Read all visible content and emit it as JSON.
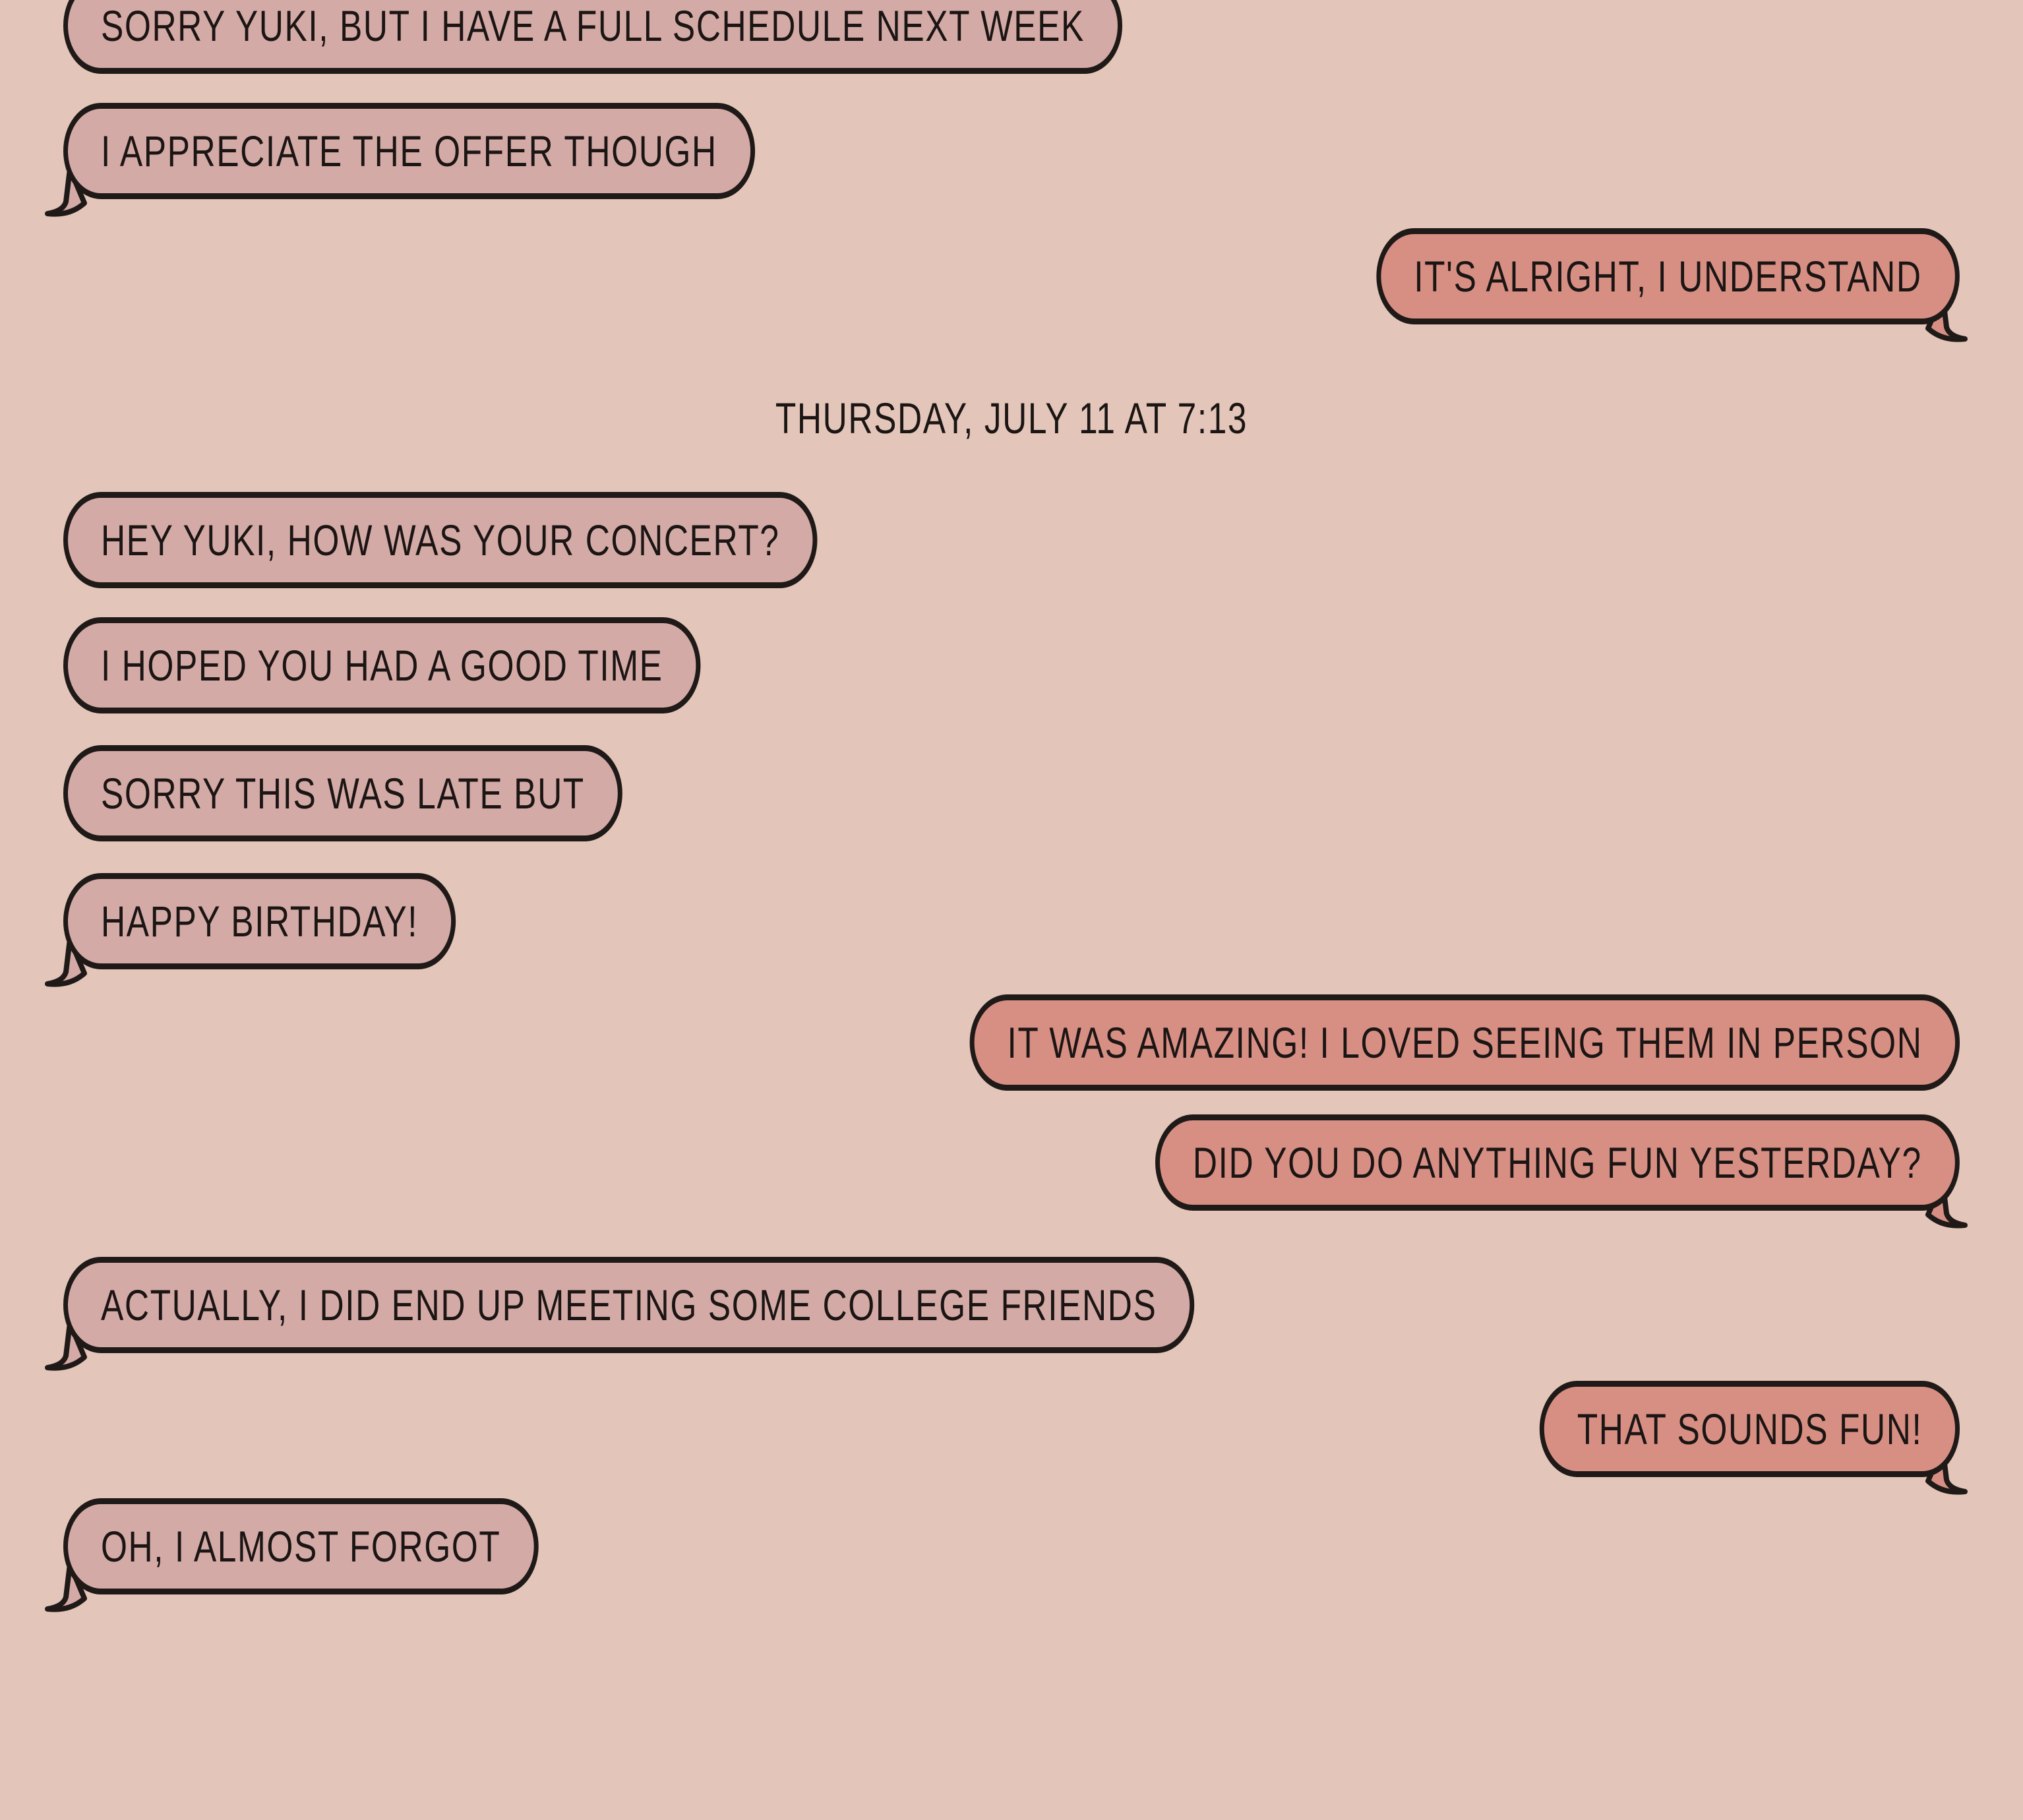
{
  "conversation": {
    "messages_before": [
      {
        "sender": "them",
        "text": "Sorry Yuki, but I have a full schedule next week"
      },
      {
        "sender": "them",
        "text": "I appreciate the offer though"
      },
      {
        "sender": "me",
        "text": "It's alright, I understand"
      }
    ],
    "timestamp": "Thursday, July 11 at 7:13",
    "messages_after": [
      {
        "sender": "them",
        "text": "Hey Yuki, how was your concert?"
      },
      {
        "sender": "them",
        "text": "I hoped you had a good time"
      },
      {
        "sender": "them",
        "text": "Sorry this was late but"
      },
      {
        "sender": "them",
        "text": "Happy birthday!"
      },
      {
        "sender": "me",
        "text": "It was amazing! I loved seeing them in person"
      },
      {
        "sender": "me",
        "text": "Did you do anything fun yesterday?"
      },
      {
        "sender": "them",
        "text": "Actually, I did end up meeting some college friends"
      },
      {
        "sender": "me",
        "text": "That sounds fun!"
      },
      {
        "sender": "them",
        "text": "Oh, I almost forgot"
      }
    ]
  },
  "colors": {
    "background": "#e3c6b9",
    "incoming_bubble": "#d4aaa6",
    "outgoing_bubble": "#d78f84",
    "outline": "#1f1a18",
    "text": "#1b1514"
  }
}
